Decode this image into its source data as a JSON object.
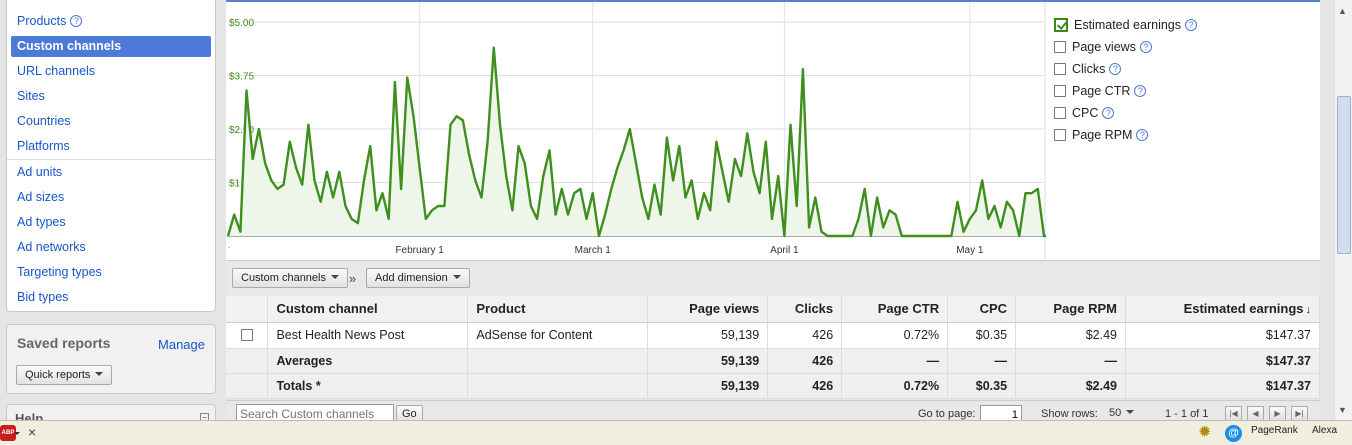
{
  "sidebar": {
    "nav_items": [
      {
        "label": "Products",
        "active": false,
        "help": true
      },
      {
        "label": "Custom channels",
        "active": true,
        "help": false
      },
      {
        "label": "URL channels",
        "active": false,
        "help": false
      },
      {
        "label": "Sites",
        "active": false,
        "help": false
      },
      {
        "label": "Countries",
        "active": false,
        "help": false
      },
      {
        "label": "Platforms",
        "active": false,
        "help": false
      },
      {
        "label": "Ad units",
        "active": false,
        "help": false
      },
      {
        "label": "Ad sizes",
        "active": false,
        "help": false
      },
      {
        "label": "Ad types",
        "active": false,
        "help": false
      },
      {
        "label": "Ad networks",
        "active": false,
        "help": false
      },
      {
        "label": "Targeting types",
        "active": false,
        "help": false
      },
      {
        "label": "Bid types",
        "active": false,
        "help": false
      }
    ],
    "saved_reports": {
      "title": "Saved reports",
      "manage": "Manage",
      "quick_reports": "Quick reports"
    },
    "help": {
      "title": "Help",
      "toggle": "−"
    }
  },
  "chart_data": {
    "type": "area",
    "y_ticks": [
      "$5.00",
      "$3.75",
      "$2.50",
      "$1.25"
    ],
    "x_ticks": [
      "February 1",
      "March 1",
      "April 1",
      "May 1"
    ],
    "x_tick_days": [
      31,
      59,
      90,
      120
    ],
    "ylim": [
      0,
      5
    ],
    "xlim": [
      0,
      132
    ],
    "series_color": "#3f8f1e",
    "values": [
      0.0,
      0.5,
      0.1,
      3.4,
      1.8,
      2.5,
      1.7,
      1.3,
      1.1,
      1.2,
      2.2,
      1.6,
      1.2,
      2.6,
      1.3,
      0.8,
      1.5,
      0.9,
      1.5,
      0.7,
      0.4,
      0.3,
      1.3,
      2.1,
      0.6,
      1.0,
      0.4,
      3.6,
      1.1,
      3.7,
      2.8,
      1.6,
      0.4,
      0.6,
      0.7,
      0.7,
      2.6,
      2.8,
      2.7,
      1.9,
      1.3,
      0.9,
      2.2,
      4.4,
      2.6,
      1.4,
      0.6,
      2.1,
      1.7,
      0.7,
      0.4,
      1.4,
      2.0,
      0.5,
      1.1,
      0.5,
      1.0,
      1.1,
      0.4,
      1.0,
      0.0,
      0.5,
      1.1,
      1.6,
      2.0,
      2.5,
      1.7,
      0.9,
      0.4,
      1.2,
      0.5,
      2.3,
      1.3,
      2.1,
      0.9,
      1.3,
      0.4,
      1.0,
      0.6,
      2.2,
      1.5,
      0.8,
      1.8,
      1.4,
      2.4,
      1.5,
      1.0,
      2.2,
      0.4,
      1.4,
      0.0,
      2.6,
      0.7,
      3.9,
      0.2,
      0.9,
      0.1,
      0.0,
      0.0,
      0.0,
      0.0,
      0.0,
      0.4,
      1.1,
      0.0,
      0.9,
      0.2,
      0.6,
      0.5,
      0.0,
      0.0,
      0.0,
      0.0,
      0.0,
      0.0,
      0.0,
      0.0,
      0.0,
      0.8,
      0.1,
      0.4,
      0.6,
      1.3,
      0.4,
      0.7,
      0.2,
      0.8,
      0.6,
      0.0,
      1.0,
      1.0,
      1.1,
      0.0,
      0.0
    ],
    "grid": true
  },
  "metrics": [
    {
      "label": "Estimated earnings",
      "checked": true
    },
    {
      "label": "Page views",
      "checked": false
    },
    {
      "label": "Clicks",
      "checked": false
    },
    {
      "label": "Page CTR",
      "checked": false
    },
    {
      "label": "CPC",
      "checked": false
    },
    {
      "label": "Page RPM",
      "checked": false
    }
  ],
  "toolbar": {
    "dimension": "Custom channels",
    "separator": "»",
    "add_dimension": "Add dimension"
  },
  "table": {
    "headers": {
      "channel": "Custom channel",
      "product": "Product",
      "page_views": "Page views",
      "clicks": "Clicks",
      "page_ctr": "Page CTR",
      "cpc": "CPC",
      "page_rpm": "Page RPM",
      "earnings": "Estimated earnings",
      "sort_arrow": "↓"
    },
    "row": {
      "channel": "Best Health News Post",
      "product": "AdSense for Content",
      "page_views": "59,139",
      "clicks": "426",
      "page_ctr": "0.72%",
      "cpc": "$0.35",
      "page_rpm": "$2.49",
      "earnings": "$147.37"
    },
    "averages": {
      "label": "Averages",
      "page_views": "59,139",
      "clicks": "426",
      "page_ctr": "—",
      "cpc": "—",
      "page_rpm": "—",
      "earnings": "$147.37"
    },
    "totals": {
      "label": "Totals *",
      "page_views": "59,139",
      "clicks": "426",
      "page_ctr": "0.72%",
      "cpc": "$0.35",
      "page_rpm": "$2.49",
      "earnings": "$147.37"
    }
  },
  "footer": {
    "search_placeholder": "Search Custom channels",
    "go": "Go",
    "go_to_page": "Go to page:",
    "page": "1",
    "show_rows": "Show rows:",
    "rows": "50",
    "range": "1 - 1 of 1"
  },
  "statusbar": {
    "abp": "ABP",
    "close": "×",
    "pagerank": "PageRank",
    "alexa": "Alexa"
  }
}
